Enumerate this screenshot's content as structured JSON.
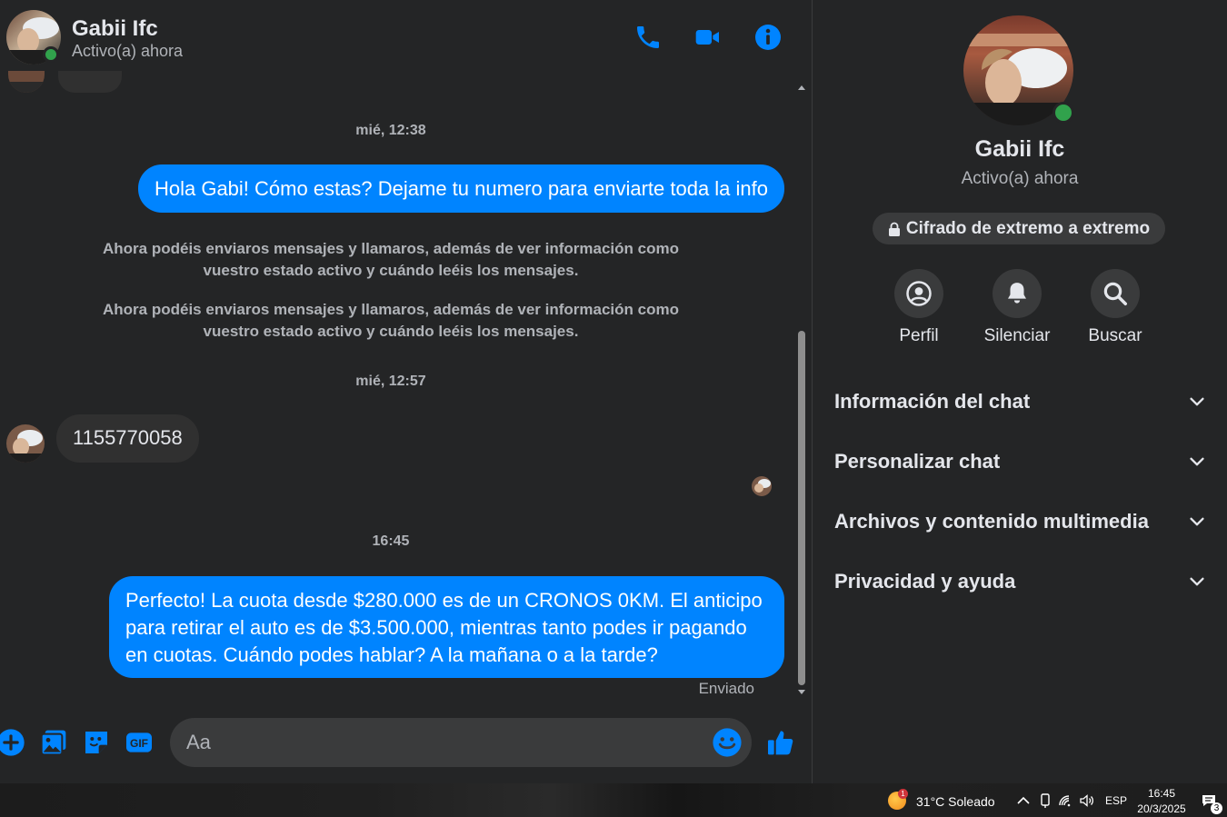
{
  "colors": {
    "accent": "#0084ff",
    "online": "#31a24c",
    "background": "#242526",
    "bubble_in": "#303030"
  },
  "header": {
    "name": "Gabii Ifc",
    "status": "Activo(a) ahora",
    "icons": [
      "phone-icon",
      "video-camera-icon",
      "info-icon"
    ]
  },
  "messages": {
    "ts1": "mié, 12:38",
    "out1": "Hola Gabi! Cómo estas? Dejame tu numero para enviarte toda la info",
    "sys1": "Ahora podéis enviaros mensajes y llamaros, además de ver información como vuestro estado activo y cuándo leéis los mensajes.",
    "sys2": "Ahora podéis enviaros mensajes y llamaros, además de ver información como vuestro estado activo y cuándo leéis los mensajes.",
    "ts2": "mié, 12:57",
    "in1": "1155770058",
    "ts3": "16:45",
    "out2": "Perfecto! La cuota desde $280.000 es de un CRONOS 0KM. El anticipo para retirar el auto es de $3.500.000, mientras tanto podes ir pagando en cuotas. Cuándo podes hablar? A la mañana o a la tarde?",
    "sent_status": "Enviado"
  },
  "composer": {
    "placeholder": "Aa",
    "icons": [
      "plus-icon",
      "image-icon",
      "sticker-icon",
      "gif-icon",
      "emoji-icon",
      "like-icon"
    ],
    "gif_label": "GIF"
  },
  "panel": {
    "name": "Gabii Ifc",
    "status": "Activo(a) ahora",
    "e2e_label": "Cifrado de extremo a extremo",
    "actions": [
      {
        "label": "Perfil",
        "icon": "profile-icon"
      },
      {
        "label": "Silenciar",
        "icon": "bell-icon"
      },
      {
        "label": "Buscar",
        "icon": "search-icon"
      }
    ],
    "sections": [
      {
        "label": "Información del chat"
      },
      {
        "label": "Personalizar chat"
      },
      {
        "label": "Archivos y contenido multimedia"
      },
      {
        "label": "Privacidad y ayuda"
      }
    ]
  },
  "taskbar": {
    "weather": "31°C  Soleado",
    "weather_badge": "1",
    "language": "ESP",
    "time": "16:45",
    "date": "20/3/2025",
    "notif_count": "3"
  }
}
